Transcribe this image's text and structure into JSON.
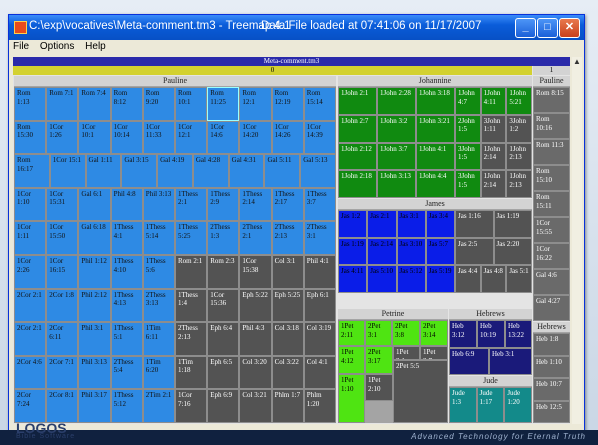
{
  "window": {
    "title": "C:\\exp\\vocatives\\Meta-comment.tm3 - Treemap 4.1",
    "status": "Data File loaded at 07:41:06 on 11/17/2007",
    "buttons": {
      "minimize": "_",
      "maximize": "□",
      "close": "✕"
    }
  },
  "menu": [
    "File",
    "Options",
    "Help"
  ],
  "treemap": {
    "root": "Meta-comment.tm3",
    "left_value": "0",
    "right_value": "1",
    "groups": {
      "pauline": "Pauline",
      "johannine": "Johannine",
      "james": "James",
      "petrine": "Petrine",
      "hebrews": "Hebrews",
      "jude": "Jude",
      "pauline2": "Pauline",
      "hebrews2": "Hebrews"
    },
    "pauline_rows": [
      [
        "Rom 1:13",
        "Rom 7:1",
        "Rom 7:4",
        "Rom 8:12",
        "Rom 9:20",
        "Rom 10:1",
        "Rom 11:25",
        "Rom 12:1",
        "Rom 12:19",
        "Rom 15:14"
      ],
      [
        "Rom 15:30",
        "1Cor 1:26",
        "1Cor 10:1",
        "1Cor 10:14",
        "1Cor 11:33",
        "1Cor 12:1",
        "1Cor 14:6",
        "1Cor 14:20",
        "1Cor 14:26",
        "1Cor 14:39"
      ],
      [
        "Rom 16:17",
        "1Cor 15:1",
        "Gal 1:11",
        "Gal 3:15",
        "Gal 4:19",
        "Gal 4:28",
        "Gal 4:31",
        "Gal 5:11",
        "Gal 5:13"
      ],
      [
        "1Cor 1:10",
        "1Cor 15:31",
        "Gal 6:1",
        "Phil 4:8",
        "Phil 3:13",
        "1Thess 2:1",
        "1Thess 2:9",
        "1Thess 2:14",
        "1Thess 2:17",
        "1Thess 3:7"
      ],
      [
        "1Cor 1:11",
        "1Cor 15:50",
        "Gal 6:18",
        "1Thess 4:1",
        "1Thess 5:14",
        "1Thess 5:25",
        "2Thess 1:3",
        "2Thess 2:1",
        "2Thess 2:13",
        "2Thess 3:1"
      ],
      [
        "1Cor 2:26",
        "1Cor 16:15",
        "Phil 1:12",
        "1Thess 4:10",
        "1Thess 5:6",
        "Rom 2:1",
        "Rom 2:3",
        "1Cor 15:38",
        "Col 3:1",
        "Phil 4:1"
      ],
      [
        "2Cor 2:1",
        "2Cor 1:8",
        "Phil 2:12",
        "1Thess 4:13",
        "2Thess 3:13",
        "1Thess 1:4",
        "1Cor 15:36",
        "Eph 5:22",
        "Eph 5:25",
        "Eph 6:1"
      ],
      [
        "2Cor 2:1",
        "2Cor 6:11",
        "Phil 3:1",
        "1Thess 5:1",
        "1Tim 6:11",
        "2Thess 2:13",
        "Eph 6:4",
        "Phil 4:3",
        "Col 3:18",
        "Col 3:19"
      ],
      [
        "2Cor 4:6",
        "2Cor 7:1",
        "Phil 3:13",
        "2Thess 5:4",
        "1Tim 6:20",
        "1Tim 1:18",
        "Eph 6:5",
        "Col 3:20",
        "Col 3:22",
        "Col 4:1"
      ],
      [
        "2Cor 7:24",
        "2Cor 8:1",
        "Phil 3:17",
        "1Thess 5:12",
        "2Tim 2:1",
        "1Cor 7:16",
        "Eph 6:9",
        "Col 3:21",
        "Phlm 1:7",
        "Phlm 1:20"
      ]
    ],
    "johannine": [
      [
        "1John 2:1",
        "1John 2:28",
        "1John 3:18",
        "1John 4:7",
        "1John 4:11",
        "1John 5:21"
      ],
      [
        "1John 2:7",
        "1John 3:2",
        "1John 3:21",
        "2John 1:5",
        "3John 1:11",
        "3John 1:2"
      ],
      [
        "1John 2:12",
        "1John 3:7",
        "1John 4:1",
        "3John 1:5",
        "1John 2:14",
        "1John 2:13"
      ],
      [
        "1John 2:18",
        "1John 3:13",
        "1John 4:4",
        "3John 1:5",
        "1John 2:14",
        "1John 2:13"
      ]
    ],
    "james_blue": [
      "Jas 1:2",
      "Jas 2:1",
      "Jas 3:1",
      "Jas 3:4",
      "Jas 1:19",
      "Jas 2:14",
      "Jas 3:10",
      "Jas 5:7",
      "Jas 4:11",
      "Jas 5:10",
      "Jas 5:12",
      "Jas 5:19"
    ],
    "james_gray": [
      "Jas 1:16",
      "Jas 1:19",
      "Jas 2:5",
      "Jas 2:20",
      "Jas 4:4",
      "Jas 4:8",
      "Jas 5:1"
    ],
    "petrine": [
      "1Pet 2:11",
      "2Pet 3:1",
      "2Pet 3:8",
      "2Pet 3:14",
      "1Pet 4:12",
      "2Pet 3:17",
      "1Pet 3:1",
      "1Pet 3:7",
      "1Pet 1:10",
      "1Pet 2:10",
      "2Pet 5:5"
    ],
    "hebrews": [
      "Heb 3:12",
      "Heb 10:19",
      "Heb 13:22",
      "Heb 6:9",
      "Heb 3:1"
    ],
    "jude": [
      "Jude 1:3",
      "Jude 1:17",
      "Jude 1:20"
    ],
    "right_col": [
      "Rom 8:15",
      "Rom 10:16",
      "Rom 11:3",
      "Rom 15:10",
      "Rom 15:11",
      "1Cor 15:55",
      "1Cor 16:22",
      "Gal 4:6",
      "Gal 4:27"
    ],
    "right_heb": [
      "Heb 1:8",
      "Heb 1:10",
      "Heb 10:7",
      "Heb 12:5"
    ]
  },
  "footer": {
    "logo": "LOGOS",
    "logo_sub": "Bible Software",
    "tagline": "Advanced Technology for Eternal Truth"
  }
}
